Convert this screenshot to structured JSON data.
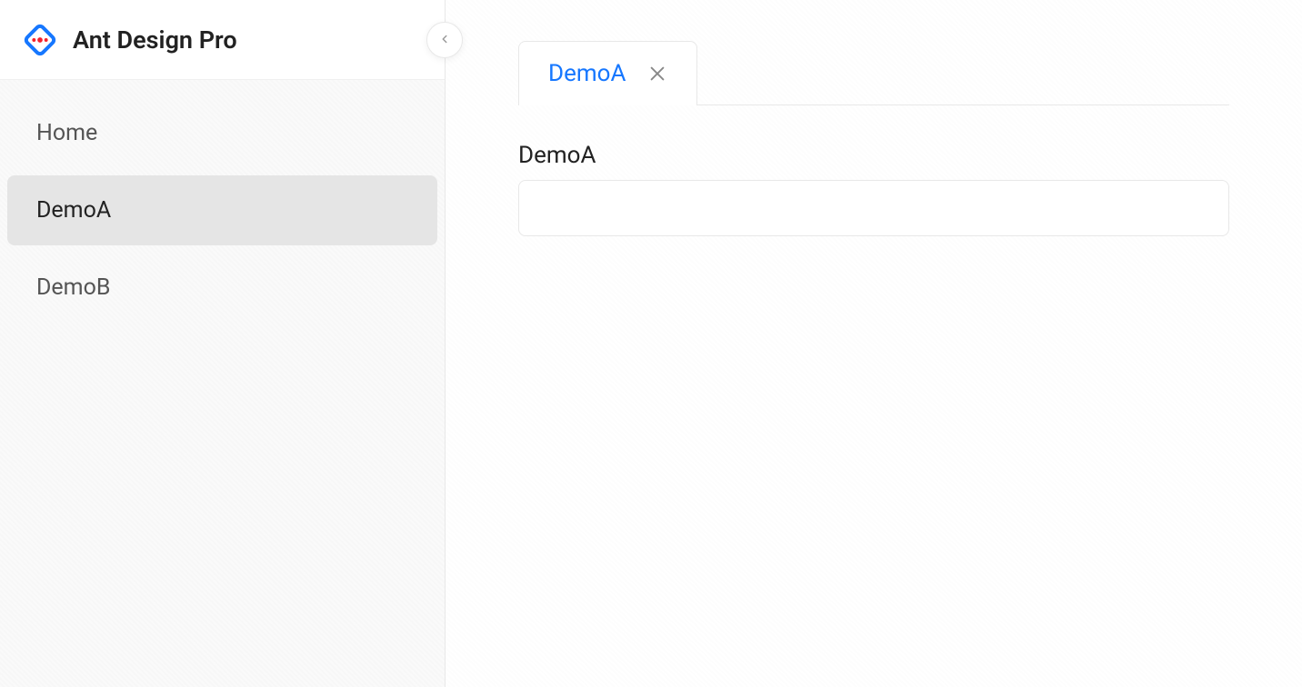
{
  "header": {
    "brand_title": "Ant Design Pro"
  },
  "sidebar": {
    "items": [
      {
        "label": "Home",
        "active": false
      },
      {
        "label": "DemoA",
        "active": true
      },
      {
        "label": "DemoB",
        "active": false
      }
    ]
  },
  "main": {
    "tabs": [
      {
        "label": "DemoA",
        "active": true
      }
    ],
    "content_title": "DemoA"
  },
  "colors": {
    "primary": "#1677ff"
  }
}
